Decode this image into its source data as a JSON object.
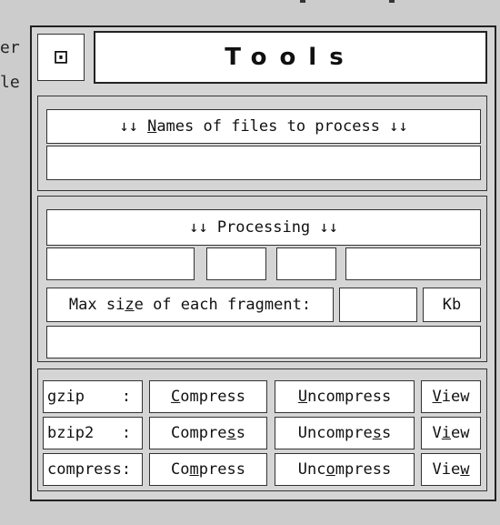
{
  "window": {
    "title": "Tools",
    "close_glyph": "⊡"
  },
  "background": {
    "left_edge_text": [
      "er",
      "le"
    ]
  },
  "files_section": {
    "header_pre": "↓↓ ",
    "header_accel": "N",
    "header_post": "ames of files to process ↓↓",
    "files_value": ""
  },
  "processing_section": {
    "header": "↓↓ Processing ↓↓",
    "status_cells": [
      "",
      "",
      "",
      ""
    ],
    "max_size_pre": "Max si",
    "max_size_accel": "z",
    "max_size_post": "e of each fragment:",
    "max_size_value": "",
    "unit": "Kb",
    "message": ""
  },
  "tools": [
    {
      "name": "gzip    :",
      "compress": {
        "pre": "",
        "accel": "C",
        "post": "ompress"
      },
      "uncompress": {
        "pre": "",
        "accel": "U",
        "post": "ncompress"
      },
      "view": {
        "pre": "",
        "accel": "V",
        "post": "iew"
      }
    },
    {
      "name": "bzip2   :",
      "compress": {
        "pre": "Compre",
        "accel": "s",
        "post": "s"
      },
      "uncompress": {
        "pre": "Uncompre",
        "accel": "s",
        "post": "s"
      },
      "view": {
        "pre": "V",
        "accel": "i",
        "post": "ew"
      }
    },
    {
      "name": "compress:",
      "compress": {
        "pre": "Co",
        "accel": "m",
        "post": "press"
      },
      "uncompress": {
        "pre": "Unc",
        "accel": "o",
        "post": "mpress"
      },
      "view": {
        "pre": "Vie",
        "accel": "w",
        "post": ""
      }
    }
  ],
  "colors": {
    "frame": "#222222",
    "panel": "#e4e4e4",
    "field": "#ffffff"
  }
}
